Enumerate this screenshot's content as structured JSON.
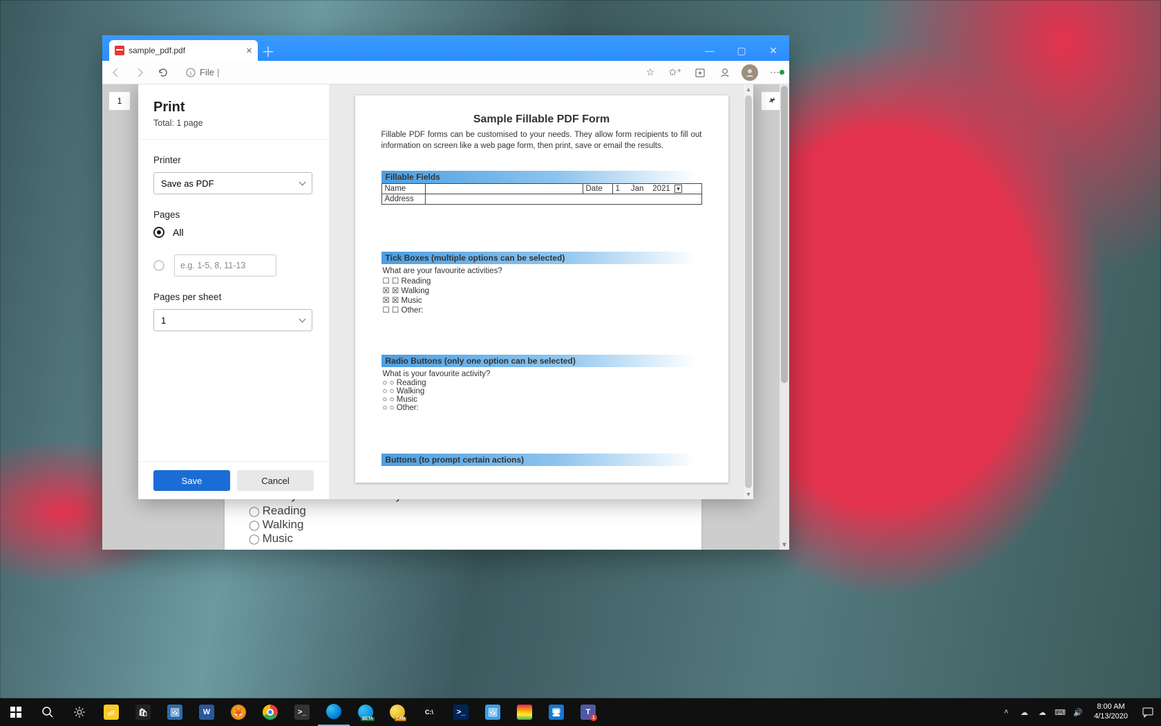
{
  "browser": {
    "tab_title": "sample_pdf.pdf",
    "address_prefix": "File",
    "address_sep": "|",
    "page_indicator": "1"
  },
  "print_dialog": {
    "title": "Print",
    "total": "Total: 1 page",
    "printer_label": "Printer",
    "printer_value": "Save as PDF",
    "pages_label": "Pages",
    "pages_all": "All",
    "pages_range_placeholder": "e.g. 1-5, 8, 11-13",
    "pps_label": "Pages per sheet",
    "pps_value": "1",
    "save": "Save",
    "cancel": "Cancel"
  },
  "pdf": {
    "title": "Sample Fillable PDF Form",
    "desc": "Fillable PDF forms can be customised to your needs. They allow form recipients to fill out information on screen like a web page form, then print, save or email the results.",
    "sec_fillable": "Fillable Fields",
    "name_label": "Name",
    "date_label": "Date",
    "date_day": "1",
    "date_mon": "Jan",
    "date_year": "2021",
    "addr_label": "Address",
    "sec_tick": "Tick Boxes (multiple options can be selected)",
    "tick_q": "What are your favourite activities?",
    "tick_opts": [
      "Reading",
      "Walking",
      "Music",
      "Other:"
    ],
    "sec_radio": "Radio Buttons (only one option can be selected)",
    "radio_q": "What is your favourite activity?",
    "radio_opts": [
      "Reading",
      "Walking",
      "Music",
      "Other:"
    ],
    "sec_buttons": "Buttons (to prompt certain actions)"
  },
  "behind": {
    "q": "What is your favourite activity?",
    "opts": [
      "Reading",
      "Walking",
      "Music"
    ]
  },
  "tray": {
    "time": "8:00 AM",
    "date": "4/13/2020"
  }
}
